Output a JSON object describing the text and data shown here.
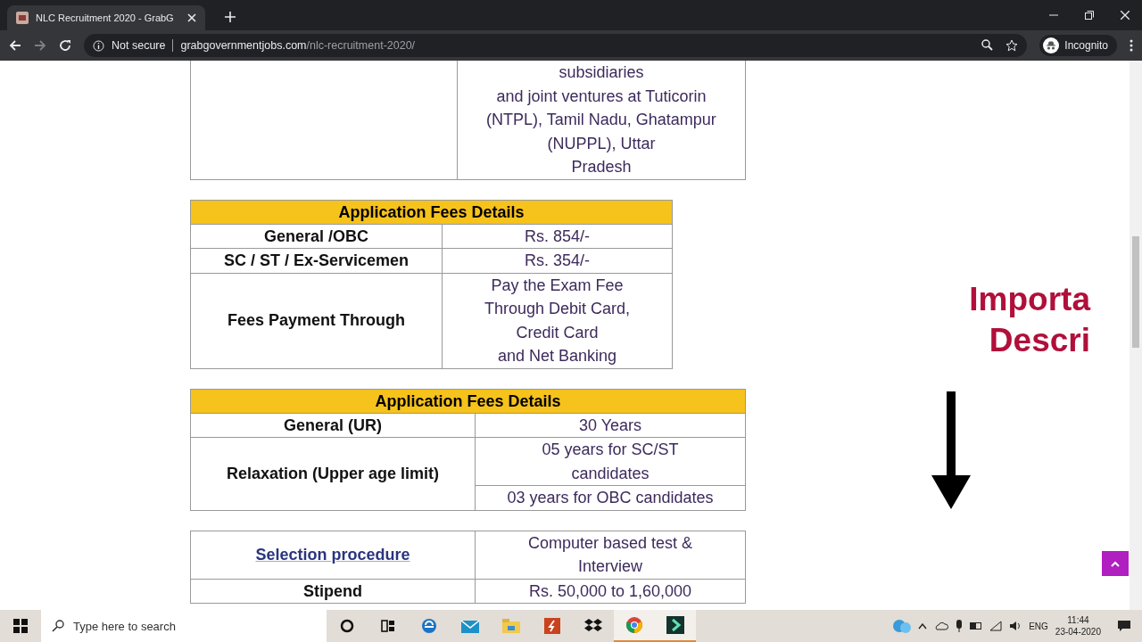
{
  "browser": {
    "tab": {
      "title": "NLC Recruitment 2020 - GrabG",
      "selected": true
    },
    "address": {
      "security": "Not secure",
      "domain": "grabgovernmentjobs.com",
      "path": "/nlc-recruitment-2020/"
    },
    "profile": "Incognito"
  },
  "location_table": {
    "lines": [
      "subsidiaries",
      "and joint ventures at Tuticorin",
      "(NTPL), Tamil Nadu, Ghatampur",
      "(NUPPL), Uttar",
      "Pradesh"
    ]
  },
  "fees_table": {
    "title": "Application Fees Details",
    "rows": [
      {
        "label": "General /OBC",
        "values": [
          [
            "Rs. 854/-"
          ]
        ]
      },
      {
        "label": "SC / ST / Ex-Servicemen",
        "values": [
          [
            "Rs. 354/-"
          ]
        ]
      },
      {
        "label": "Fees Payment Through",
        "values": [
          [
            "Pay the Exam Fee",
            "Through Debit Card,",
            "Credit Card",
            "and Net Banking"
          ]
        ]
      }
    ]
  },
  "age_table": {
    "title": "Application Fees Details",
    "rows": [
      {
        "label": "General (UR)",
        "values": [
          [
            "30 Years"
          ]
        ]
      },
      {
        "label": "Relaxation (Upper age limit)",
        "values": [
          [
            "05 years for SC/ST",
            "candidates"
          ],
          [
            "03 years for OBC candidates"
          ]
        ]
      }
    ]
  },
  "selection_table": {
    "rows": [
      {
        "label": "Selection procedure",
        "kind": "link",
        "values": [
          [
            "Computer based test &",
            "Interview"
          ]
        ]
      },
      {
        "label": "Stipend",
        "kind": "text",
        "values": [
          [
            "Rs. 50,000 to 1,60,000"
          ]
        ]
      }
    ]
  },
  "side_heading": [
    "Importa",
    "Descri"
  ],
  "taskbar": {
    "search": {
      "placeholder": "Type here to search"
    },
    "language": "ENG",
    "time": "11:44",
    "date": "23-04-2020"
  }
}
